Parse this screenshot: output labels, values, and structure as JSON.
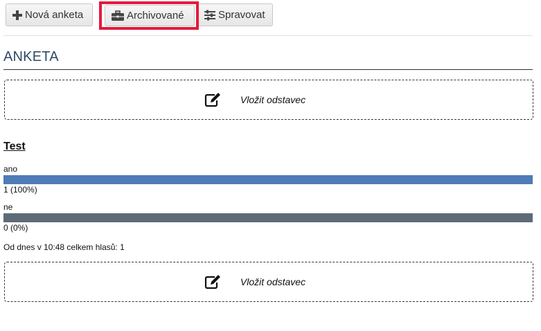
{
  "toolbar": {
    "new_label": "Nová anketa",
    "archive_label": "Archivované",
    "manage_label": "Spravovat",
    "highlight_color": "#e5193c"
  },
  "section": {
    "title": "ANKETA"
  },
  "insert_paragraph": {
    "label": "Vložit odstavec",
    "icon": "edit-icon"
  },
  "poll": {
    "title": "Test",
    "options": [
      {
        "label": "ano",
        "result": "1 (100%)",
        "fraction": 1.0,
        "color": "#4f7bb6"
      },
      {
        "label": "ne",
        "result": "0 (0%)",
        "fraction": 1.0,
        "color": "#5c6b77"
      }
    ],
    "summary": "Od dnes v 10:48 celkem hlasů: 1"
  }
}
